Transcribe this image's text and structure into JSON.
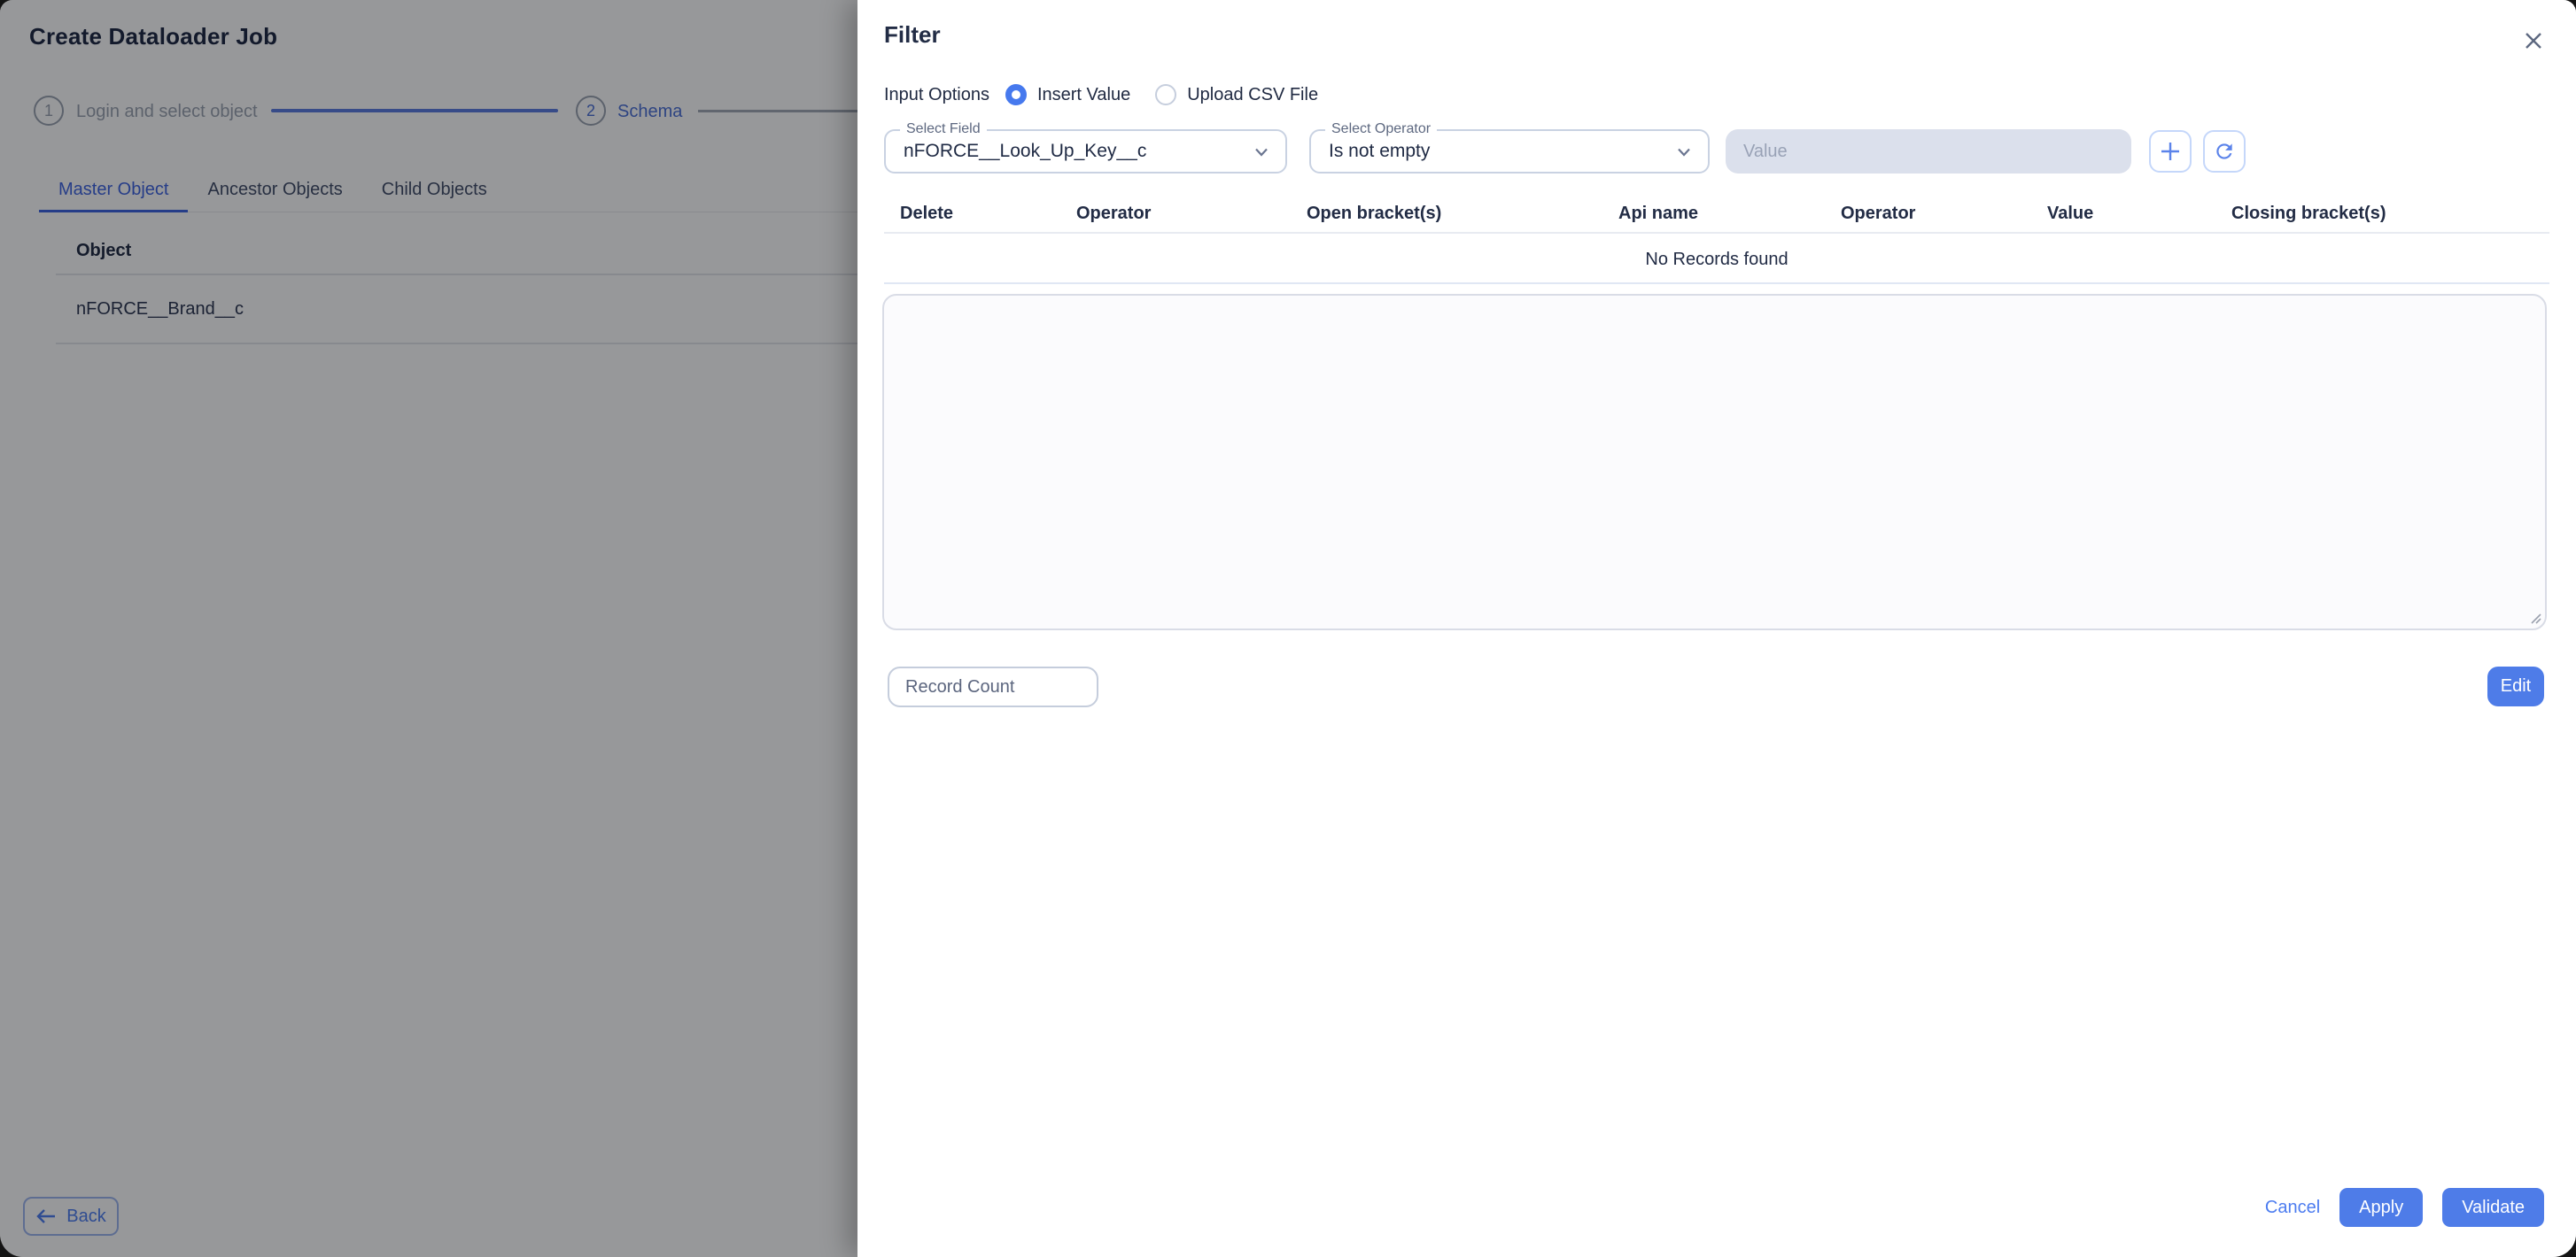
{
  "page": {
    "title": "Create Dataloader Job",
    "steps": [
      {
        "number": "1",
        "label": "Login and select object",
        "state": "inactive"
      },
      {
        "number": "2",
        "label": "Schema",
        "state": "active"
      }
    ],
    "tabs": [
      "Master Object",
      "Ancestor Objects",
      "Child Objects"
    ],
    "active_tab": "Master Object",
    "object_table": {
      "header": "Object",
      "rows": [
        "nFORCE__Brand__c"
      ]
    },
    "back_label": "Back"
  },
  "drawer": {
    "title": "Filter",
    "close_icon": "close-icon",
    "input_options": {
      "label": "Input Options",
      "options": [
        {
          "label": "Insert Value",
          "selected": true
        },
        {
          "label": "Upload CSV File",
          "selected": false
        }
      ]
    },
    "select_field": {
      "label": "Select Field",
      "value": "nFORCE__Look_Up_Key__c",
      "icon": "chevron-down-icon"
    },
    "select_operator": {
      "label": "Select Operator",
      "value": "Is not empty",
      "icon": "chevron-down-icon"
    },
    "value_input": {
      "placeholder": "Value",
      "value": "",
      "disabled": true
    },
    "add_icon": "plus-icon",
    "refresh_icon": "refresh-icon",
    "records_table": {
      "columns": [
        "Delete",
        "Operator",
        "Open bracket(s)",
        "Api name",
        "Operator",
        "Value",
        "Closing bracket(s)"
      ],
      "empty_text": "No Records found"
    },
    "query_textarea": {
      "value": ""
    },
    "record_count": {
      "placeholder": "Record Count",
      "value": ""
    },
    "edit_label": "Edit",
    "cancel_label": "Cancel",
    "apply_label": "Apply",
    "validate_label": "Validate"
  },
  "colors": {
    "accent_blue": "#4c7cf0",
    "button_blue": "#4e7ce8",
    "active_step_blue": "#4a6fd6",
    "tab_active_blue": "#3d63e0",
    "dark_text": "#222c45",
    "muted_gray": "#9aa2b0",
    "disabled_input_bg": "#dbe0ec",
    "overlay": "rgba(8,10,14,0.42)",
    "desktop_bg": "#141414"
  }
}
